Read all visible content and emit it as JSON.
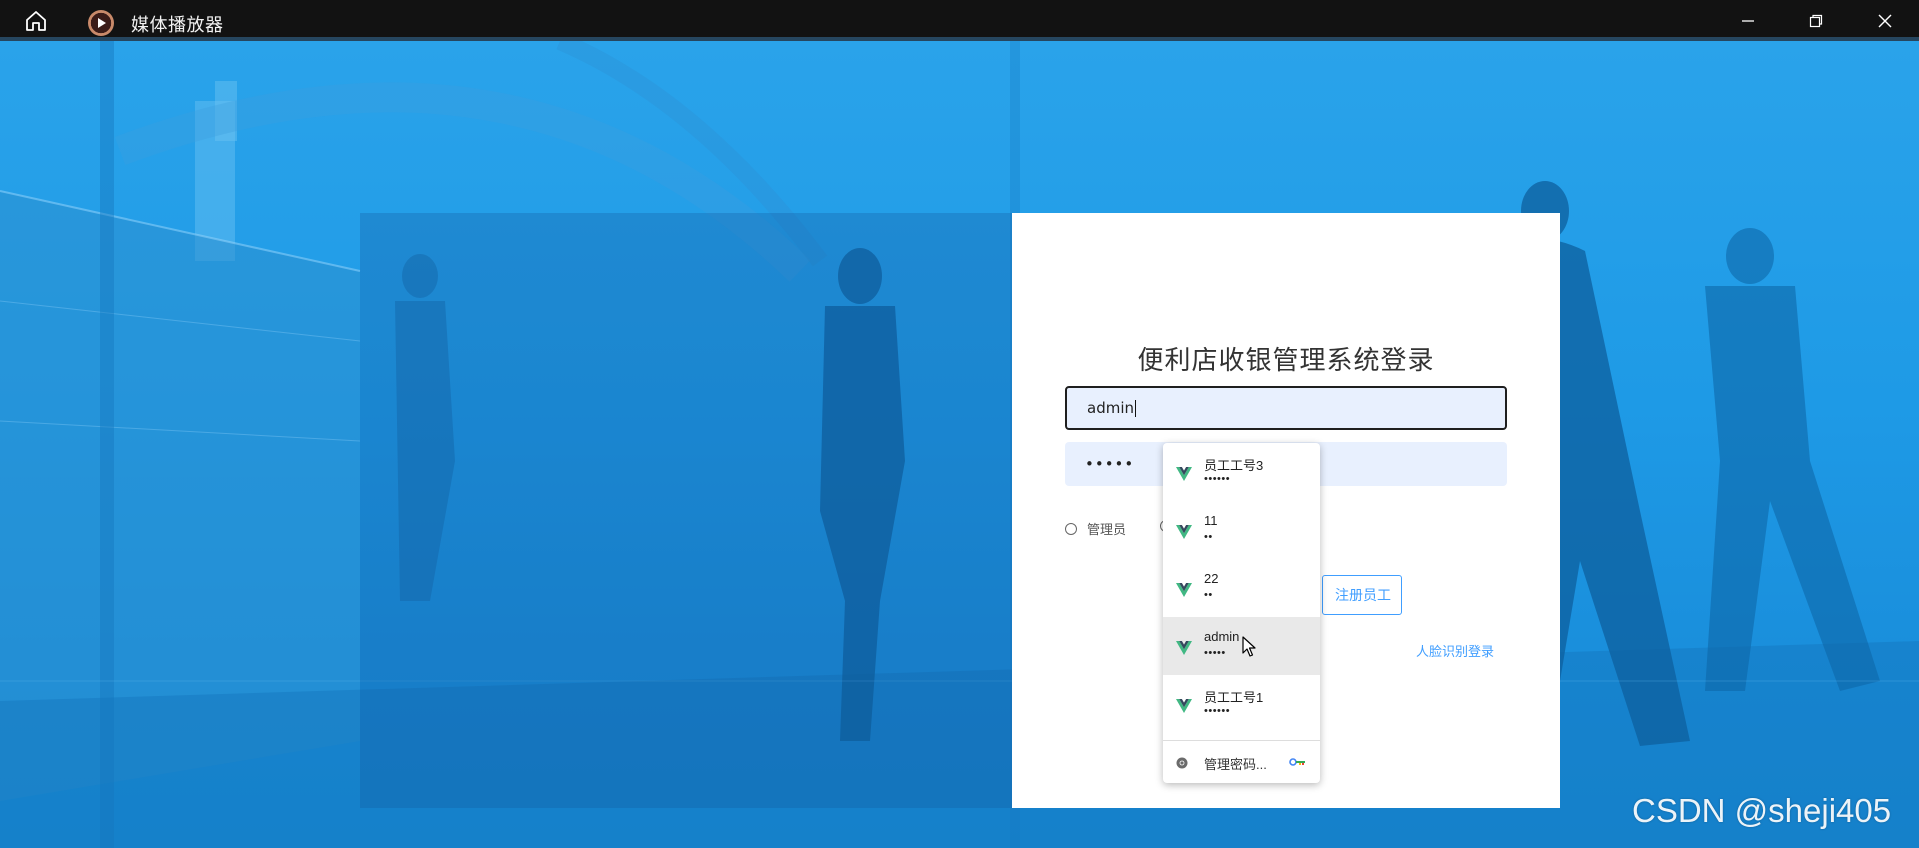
{
  "window": {
    "title": "媒体播放器",
    "controls": {
      "minimize_icon": "minimize-icon",
      "maximize_icon": "restore-icon",
      "close_icon": "close-icon"
    },
    "home_icon": "home-icon"
  },
  "login": {
    "title": "便利店收银管理系统登录",
    "username_value": "admin",
    "password_mask": "•••••",
    "role_admin_label": "管理员",
    "register_label": "注册员工",
    "face_login_label": "人脸识别登录"
  },
  "autofill": {
    "items": [
      {
        "name": "员工工号3",
        "mask": "••••••"
      },
      {
        "name": "11",
        "mask": "••"
      },
      {
        "name": "22",
        "mask": "••"
      },
      {
        "name": "admin",
        "mask": "•••••"
      },
      {
        "name": "员工工号1",
        "mask": "••••••"
      }
    ],
    "hovered_index": 3,
    "manage_label": "管理密码...",
    "manage_icon": "chrome-icon",
    "key_icon": "key-icon"
  },
  "watermark": "CSDN @sheji405",
  "colors": {
    "titlebar": "#121212",
    "background_blue": "#1e9ae6",
    "link_blue": "#409eff",
    "autofill_field": "#e8f0fe",
    "vue_green": "#41b883",
    "vue_dark": "#35495e"
  }
}
